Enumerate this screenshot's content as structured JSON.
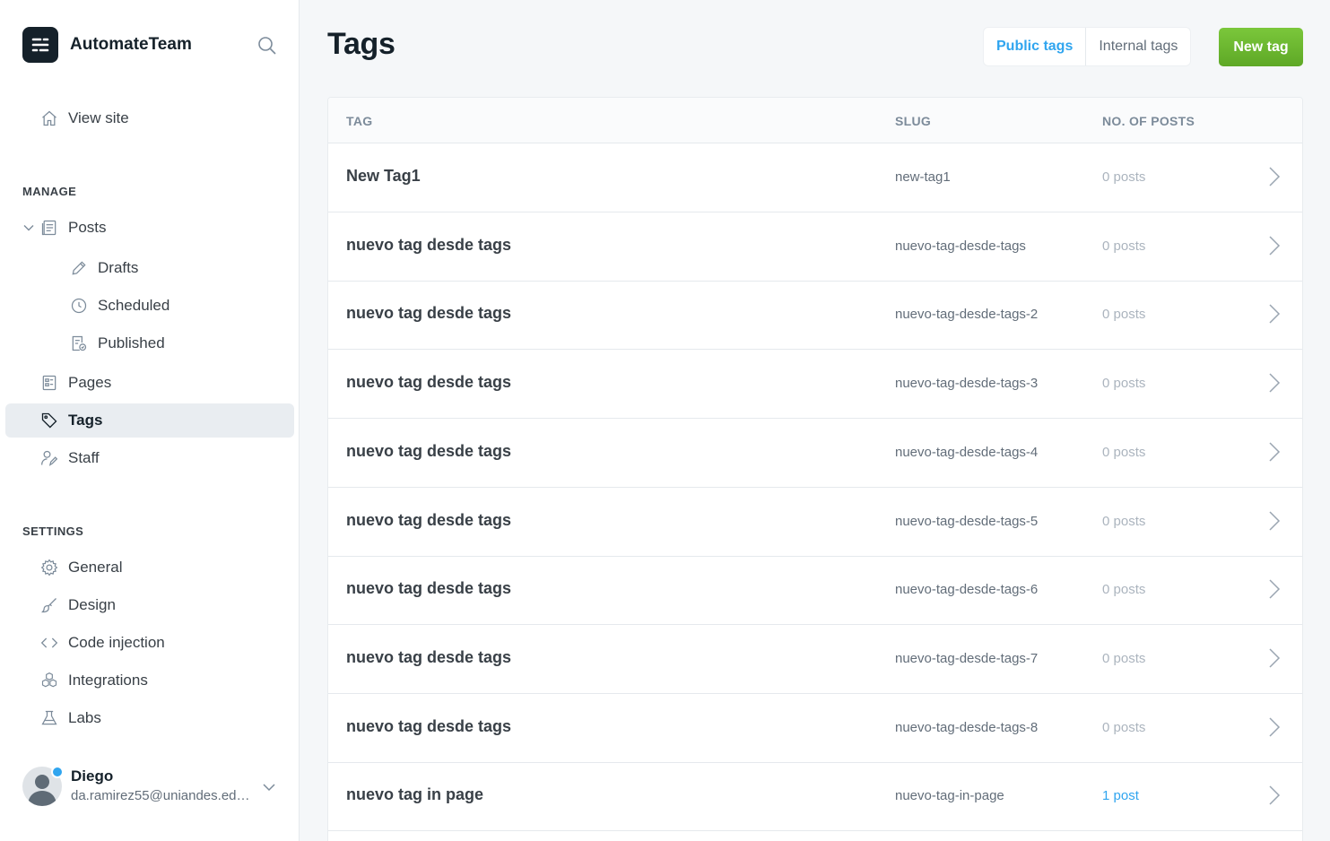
{
  "brand": {
    "name": "AutomateTeam"
  },
  "sidebar": {
    "view_site": "View site",
    "manage_title": "MANAGE",
    "settings_title": "SETTINGS",
    "manage": [
      {
        "label": "Posts",
        "icon": "posts-icon"
      },
      {
        "label": "Drafts",
        "icon": "pencil-icon"
      },
      {
        "label": "Scheduled",
        "icon": "clock-icon"
      },
      {
        "label": "Published",
        "icon": "published-icon"
      },
      {
        "label": "Pages",
        "icon": "pages-icon"
      },
      {
        "label": "Tags",
        "icon": "tag-icon",
        "active": true
      },
      {
        "label": "Staff",
        "icon": "staff-icon"
      }
    ],
    "settings": [
      {
        "label": "General",
        "icon": "gear-icon"
      },
      {
        "label": "Design",
        "icon": "brush-icon"
      },
      {
        "label": "Code injection",
        "icon": "code-icon"
      },
      {
        "label": "Integrations",
        "icon": "integrations-icon"
      },
      {
        "label": "Labs",
        "icon": "flask-icon"
      }
    ]
  },
  "user": {
    "name": "Diego",
    "email": "da.ramirez55@uniandes.edu.co"
  },
  "header": {
    "title": "Tags",
    "public_tags": "Public tags",
    "internal_tags": "Internal tags",
    "new_tag": "New tag"
  },
  "table": {
    "columns": [
      "TAG",
      "SLUG",
      "NO. OF POSTS"
    ],
    "rows": [
      {
        "tag": "New Tag1",
        "slug": "new-tag1",
        "posts": "0 posts"
      },
      {
        "tag": "nuevo tag desde tags",
        "slug": "nuevo-tag-desde-tags",
        "posts": "0 posts"
      },
      {
        "tag": "nuevo tag desde tags",
        "slug": "nuevo-tag-desde-tags-2",
        "posts": "0 posts"
      },
      {
        "tag": "nuevo tag desde tags",
        "slug": "nuevo-tag-desde-tags-3",
        "posts": "0 posts"
      },
      {
        "tag": "nuevo tag desde tags",
        "slug": "nuevo-tag-desde-tags-4",
        "posts": "0 posts"
      },
      {
        "tag": "nuevo tag desde tags",
        "slug": "nuevo-tag-desde-tags-5",
        "posts": "0 posts"
      },
      {
        "tag": "nuevo tag desde tags",
        "slug": "nuevo-tag-desde-tags-6",
        "posts": "0 posts"
      },
      {
        "tag": "nuevo tag desde tags",
        "slug": "nuevo-tag-desde-tags-7",
        "posts": "0 posts"
      },
      {
        "tag": "nuevo tag desde tags",
        "slug": "nuevo-tag-desde-tags-8",
        "posts": "0 posts"
      },
      {
        "tag": "nuevo tag in page",
        "slug": "nuevo-tag-in-page",
        "posts": "1 post"
      }
    ]
  },
  "colors": {
    "accent": "#30a5ef",
    "primary_button": "#6cbb2c",
    "text": "#15212a",
    "muted": "#abb4be"
  }
}
